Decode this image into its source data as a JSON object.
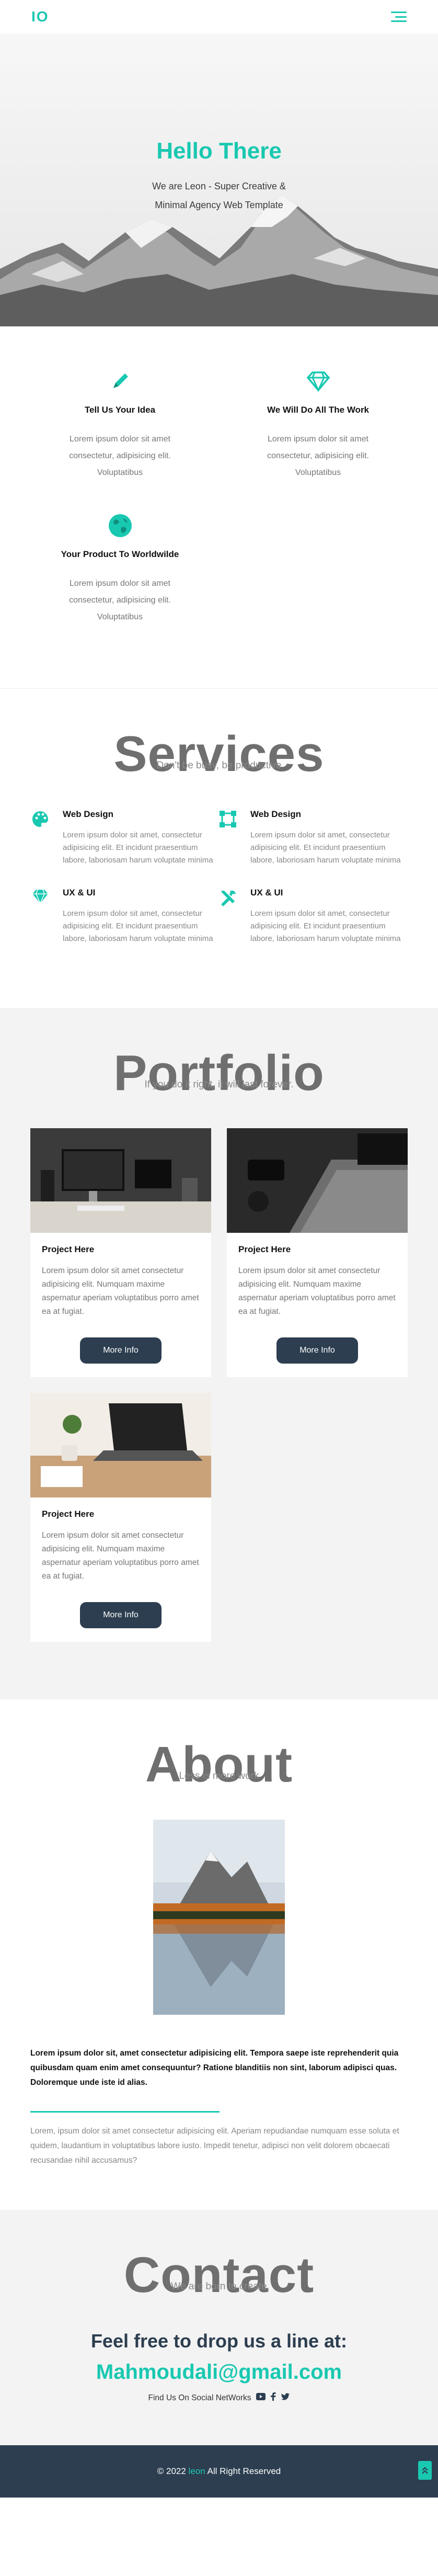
{
  "header": {
    "logo": "IO",
    "menu_icon": "hamburger-icon"
  },
  "hero": {
    "title": "Hello There",
    "subtitle": "We are Leon - Super Creative & Minimal Agency Web Template"
  },
  "features": [
    {
      "icon": "pencil-icon",
      "title": "Tell Us Your Idea",
      "text": "Lorem ipsum dolor sit amet consectetur, adipisicing elit. Voluptatibus"
    },
    {
      "icon": "diamond-icon",
      "title": "We Will Do All The Work",
      "text": "Lorem ipsum dolor sit amet consectetur, adipisicing elit. Voluptatibus"
    },
    {
      "icon": "globe-icon",
      "title": "Your Product To Worldwilde",
      "text": "Lorem ipsum dolor sit amet consectetur, adipisicing elit. Voluptatibus"
    }
  ],
  "services": {
    "title": "Services",
    "subtitle": "Don't be busy, be productive",
    "items": [
      {
        "icon": "palette-icon",
        "title": "Web Design",
        "text": "Lorem ipsum dolor sit amet, consectetur adipisicing elit. Et incidunt praesentium labore, laboriosam harum voluptate minima"
      },
      {
        "icon": "vector-square-icon",
        "title": "Web Design",
        "text": "Lorem ipsum dolor sit amet, consectetur adipisicing elit. Et incidunt praesentium labore, laboriosam harum voluptate minima"
      },
      {
        "icon": "gem-icon",
        "title": "UX & UI",
        "text": "Lorem ipsum dolor sit amet, consectetur adipisicing elit. Et incidunt praesentium labore, laboriosam harum voluptate minima"
      },
      {
        "icon": "tools-icon",
        "title": "UX & UI",
        "text": "Lorem ipsum dolor sit amet, consectetur adipisicing elit. Et incidunt praesentium labore, laboriosam harum voluptate minima"
      }
    ]
  },
  "portfolio": {
    "title": "Portfolio",
    "subtitle": "If you do it right, it will last forever.",
    "items": [
      {
        "title": "Project Here",
        "text": "Lorem ipsum dolor sit amet consectetur adipisicing elit. Numquam maxime aspernatur aperiam voluptatibus porro amet ea at fugiat.",
        "button": "More Info"
      },
      {
        "title": "Project Here",
        "text": "Lorem ipsum dolor sit amet consectetur adipisicing elit. Numquam maxime aspernatur aperiam voluptatibus porro amet ea at fugiat.",
        "button": "More Info"
      },
      {
        "title": "Project Here",
        "text": "Lorem ipsum dolor sit amet consectetur adipisicing elit. Numquam maxime aspernatur aperiam voluptatibus porro amet ea at fugiat.",
        "button": "More Info"
      }
    ]
  },
  "about": {
    "title": "About",
    "subtitle": "Less is more work",
    "bold_text": "Lorem ipsum dolor sit, amet consectetur adipisicing elit. Tempora saepe iste reprehenderit quia quibusdam quam enim amet consequuntur? Ratione blanditiis non sint, laborum adipisci quas. Doloremque unde iste id alias.",
    "light_text": "Lorem, ipsum dolor sit amet consectetur adipisicing elit. Aperiam repudiandae numquam esse soluta et quidem, laudantium in voluptatibus labore iusto. Impedit tenetur, adipisci non velit dolorem obcaecati recusandae nihil accusamus?"
  },
  "contact": {
    "title": "Contact",
    "subtitle": "We are born to create",
    "drop_line": "Feel free to drop us a line at:",
    "email": "Mahmoudali@gmail.com",
    "social_label": "Find Us On Social NetWorks"
  },
  "footer": {
    "copyright": "© 2022",
    "brand": "leon",
    "rights": "All Right Reserved"
  },
  "colors": {
    "accent": "#19c8b1",
    "dark": "#2c3e50"
  }
}
